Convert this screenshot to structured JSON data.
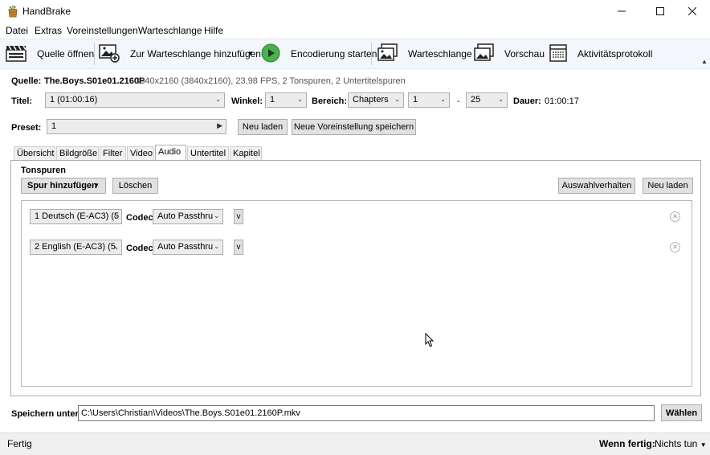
{
  "window": {
    "title": "HandBrake"
  },
  "menu": [
    "Datei",
    "Extras",
    "Voreinstellungen",
    "Warteschlange",
    "Hilfe"
  ],
  "toolbar": {
    "open_source": "Quelle öffnen",
    "add_queue": "Zur Warteschlange hinzufügen",
    "start": "Encodierung starten",
    "queue": "Warteschlange",
    "preview": "Vorschau",
    "activity_log": "Aktivitätsprotokoll"
  },
  "source": {
    "label": "Quelle:",
    "name": "The.Boys.S01e01.2160P",
    "info": "3840x2160 (3840x2160), 23,98 FPS, 2 Tonspuren, 2 Untertitelspuren"
  },
  "title_row": {
    "title_label": "Titel:",
    "title_value": "1 (01:00:16)",
    "angle_label": "Winkel:",
    "angle_value": "1",
    "range_label": "Bereich:",
    "range_type": "Chapters",
    "range_start": "1",
    "range_dash": "-",
    "range_end": "25",
    "duration_label": "Dauer:",
    "duration_value": "01:00:17"
  },
  "preset": {
    "label": "Preset:",
    "value": "1",
    "reload": "Neu laden",
    "save_new": "Neue Voreinstellung speichern"
  },
  "tabs": [
    "Übersicht",
    "Bildgröße",
    "Filter",
    "Video",
    "Audio",
    "Untertitel",
    "Kapitel"
  ],
  "active_tab": "Audio",
  "audio": {
    "section_title": "Tonspuren",
    "add_track": "Spur hinzufügen",
    "delete": "Löschen",
    "selection_behavior": "Auswahlverhalten",
    "reload": "Neu laden",
    "codec_label": "Codec",
    "tracks": [
      {
        "source": "1 Deutsch (E-AC3) (5",
        "codec": "Auto Passthru",
        "expand": "v"
      },
      {
        "source": "2 English (E-AC3) (5.",
        "codec": "Auto Passthru",
        "expand": "v"
      }
    ]
  },
  "save": {
    "label": "Speichern unter:",
    "path": "C:\\Users\\Christian\\Videos\\The.Boys.S01e01.2160P.mkv",
    "choose": "Wählen"
  },
  "status": {
    "text": "Fertig",
    "when_done_label": "Wenn fertig:",
    "when_done_value": "Nichts tun"
  },
  "icons": {
    "app": "handbrake-pineapple-icon",
    "open_source": "clapperboard-icon",
    "add_queue": "add-image-icon",
    "start": "play-icon",
    "queue": "queue-images-icon",
    "preview": "preview-images-icon",
    "activity_log": "activity-log-icon"
  },
  "colors": {
    "accent_play": "#4caf50",
    "toolbar_bg": "#f3f6fb"
  }
}
